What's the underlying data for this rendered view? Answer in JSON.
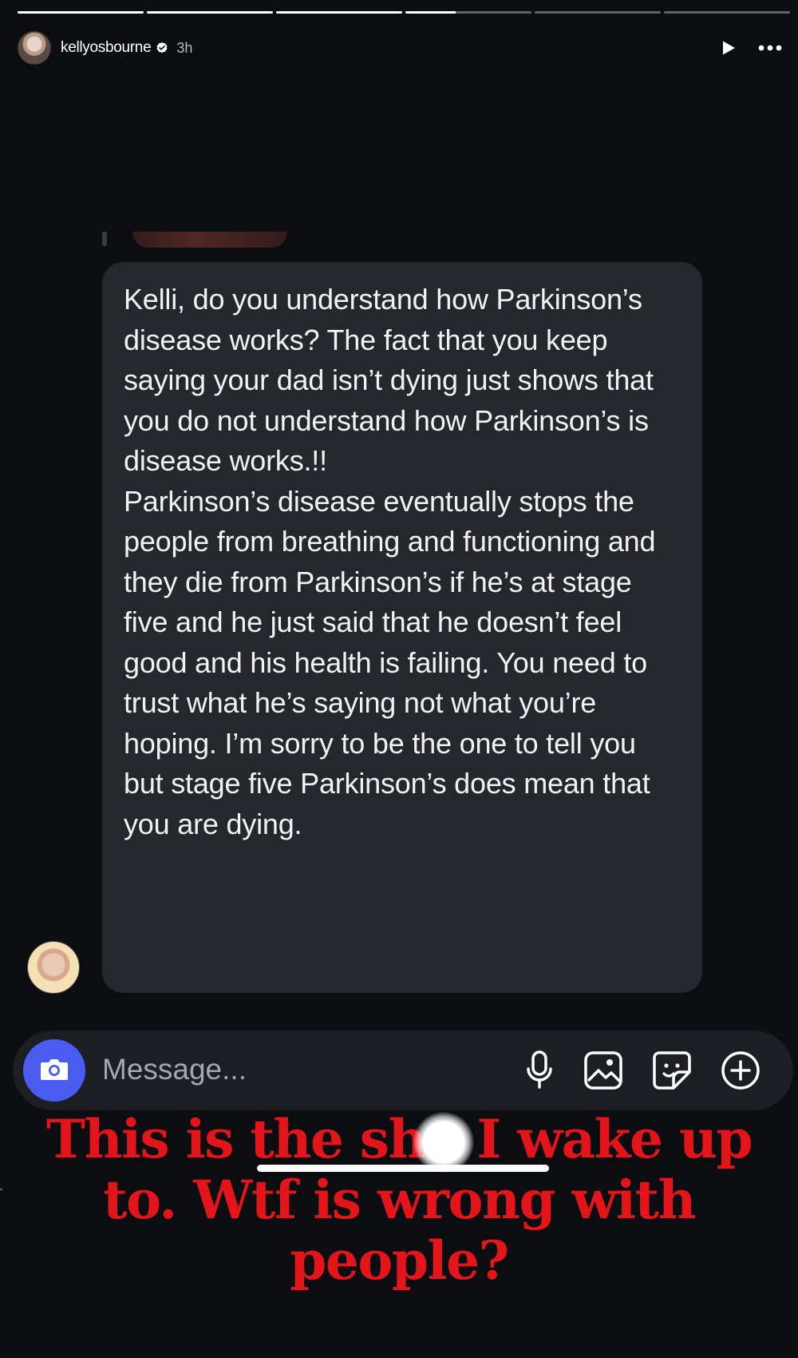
{
  "story": {
    "progress": [
      1,
      1,
      1,
      0.4,
      0,
      0
    ],
    "username": "kellyosbourne",
    "verified": true,
    "time": "3h",
    "icons": {
      "play": "play-icon",
      "more": "more-icon",
      "verified": "verified-badge-icon"
    }
  },
  "message": {
    "paragraphs": [
      "Kelli, do you understand how Parkinson’s disease works? The fact that you keep saying your dad isn’t dying just shows that you do not understand how Parkinson’s is disease works.!!",
      "Parkinson’s disease eventually stops the people from breathing and functioning and they die from Parkinson’s if he’s at stage five and he just said that he doesn’t feel good and his health is failing. You need to trust what he’s saying not what you’re hoping. I’m sorry to be the one to tell you but stage five Parkinson’s does mean that you are dying."
    ]
  },
  "composer": {
    "placeholder": "Message...",
    "icons": [
      "camera-icon",
      "microphone-icon",
      "gallery-icon",
      "sticker-icon",
      "plus-icon"
    ]
  },
  "caption": {
    "lines": [
      "This is the sh   I wake up",
      "to. Wtf is wrong with",
      "people?"
    ]
  },
  "colors": {
    "background": "#0c0d11",
    "bubble": "#26272c",
    "camera_button": "#4a5cf0",
    "caption": "#e3141a"
  }
}
